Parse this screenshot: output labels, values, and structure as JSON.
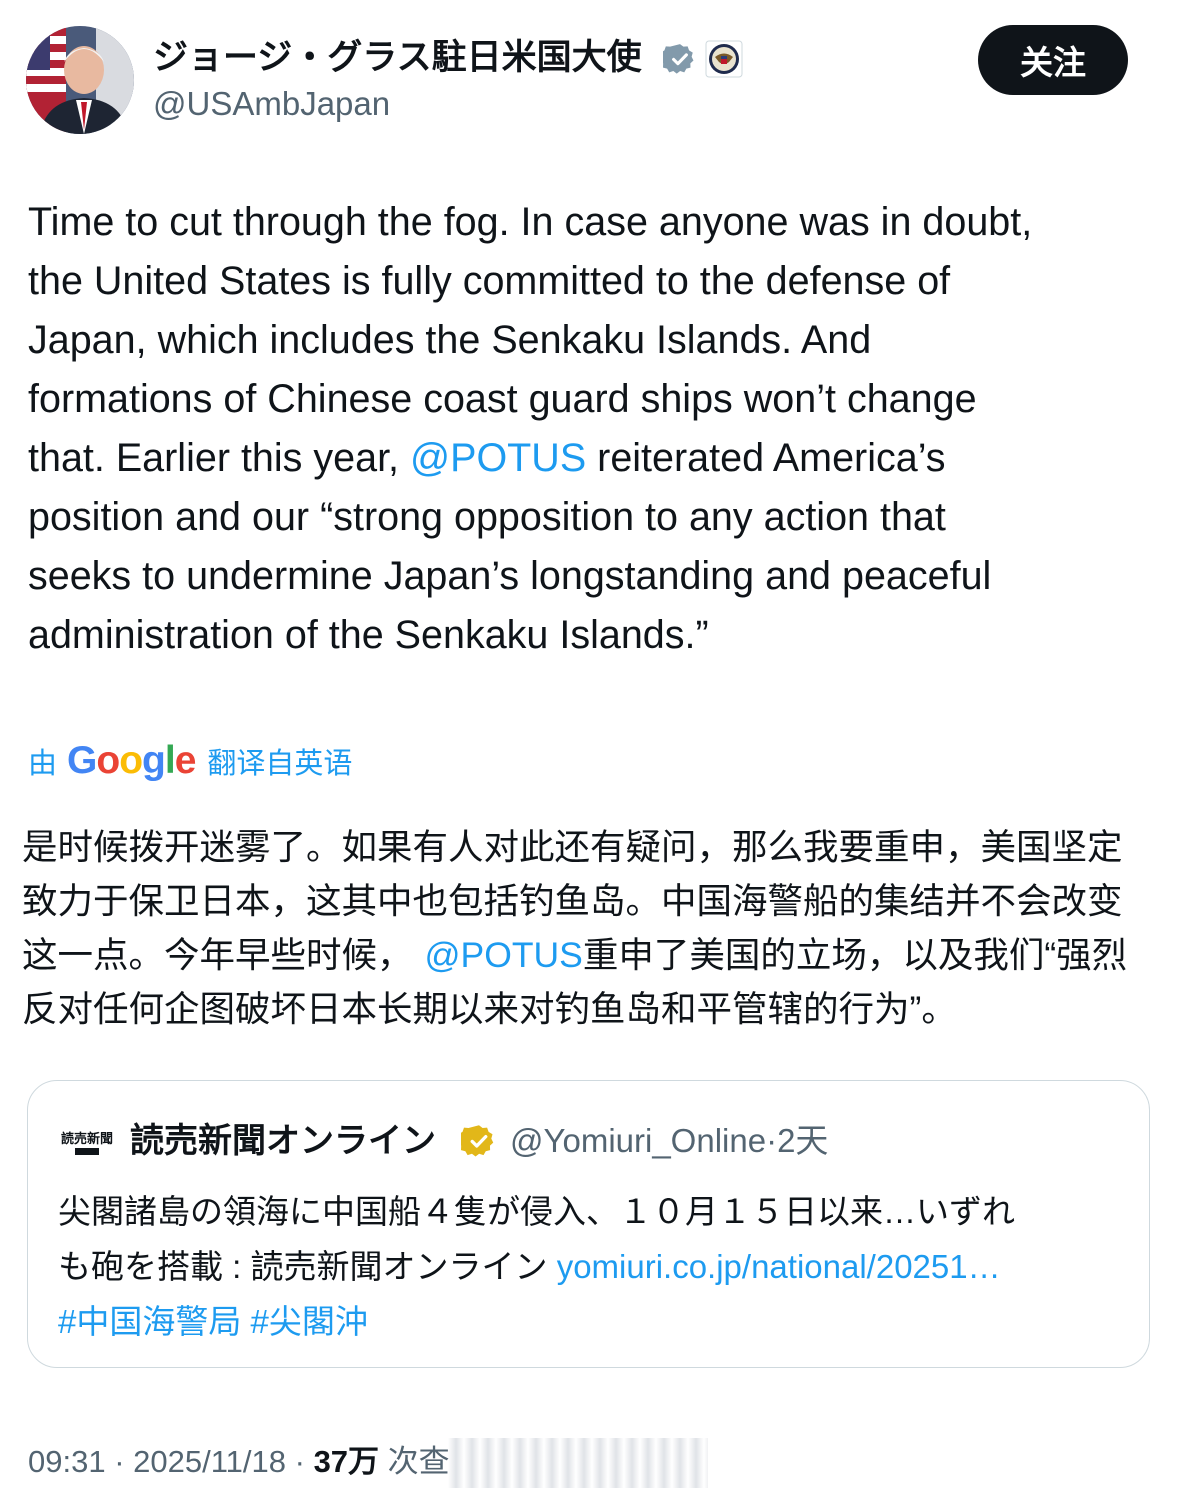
{
  "author": {
    "display_name": "ジョージ・グラス駐日米国大使",
    "handle": "@USAmbJapan",
    "verified_icon": "verified-badge-icon",
    "affiliation_icon": "us-state-department-seal-icon"
  },
  "follow_button": {
    "label": "关注"
  },
  "tweet": {
    "lines": [
      "Time to cut through the fog. In case anyone was in doubt,",
      "the United States is fully committed to the defense of",
      "Japan, which includes the Senkaku Islands. And",
      "formations of Chinese coast guard ships won’t change",
      "that. Earlier this year, ",
      "position and our “strong opposition to any action that",
      "seeks to undermine Japan’s longstanding and peaceful",
      "administration of the Senkaku Islands.”"
    ],
    "mention": "@POTUS",
    "line5_after_mention": " reiterated America’s"
  },
  "translation": {
    "by": "由",
    "provider": "Google",
    "from": "翻译自英语",
    "lines": [
      "是时候拨开迷雾了。如果有人对此还有疑问，那么我要重申，美国坚定",
      "致力于保卫日本，这其中也包括钓鱼岛。中国海警船的集结并不会改变",
      "这一点。今年早些时候，",
      "反对任何企图破坏日本长期以来对钓鱼岛和平管辖的行为”。"
    ],
    "mention": "@POTUS",
    "line3_after_mention": "重申了美国的立场，以及我们“强烈"
  },
  "quote": {
    "logo_text": "読売新聞",
    "name": "読売新聞オンライン",
    "handle": "@Yomiuri_Online",
    "separator": "·",
    "time": "2天",
    "text_line1": "尖閣諸島の領海に中国船４隻が侵入、１０月１５日以来…いずれ",
    "text_line2": "も砲を搭載 : 読売新聞オンライン ",
    "link": "yomiuri.co.jp/national/20251…",
    "hashtags": [
      "#中国海警局",
      "#尖閣沖"
    ]
  },
  "footer": {
    "time": "09:31",
    "sep1": " · ",
    "date": "2025/11/18",
    "sep2": " · ",
    "views": "37万",
    "views_label": " 次查"
  },
  "colors": {
    "text": "#0f1419",
    "secondary": "#536471",
    "link": "#1d9bf0",
    "verified_blue": "#1d9bf0",
    "verified_gold": "#e2b719",
    "border": "#cfd9de"
  }
}
